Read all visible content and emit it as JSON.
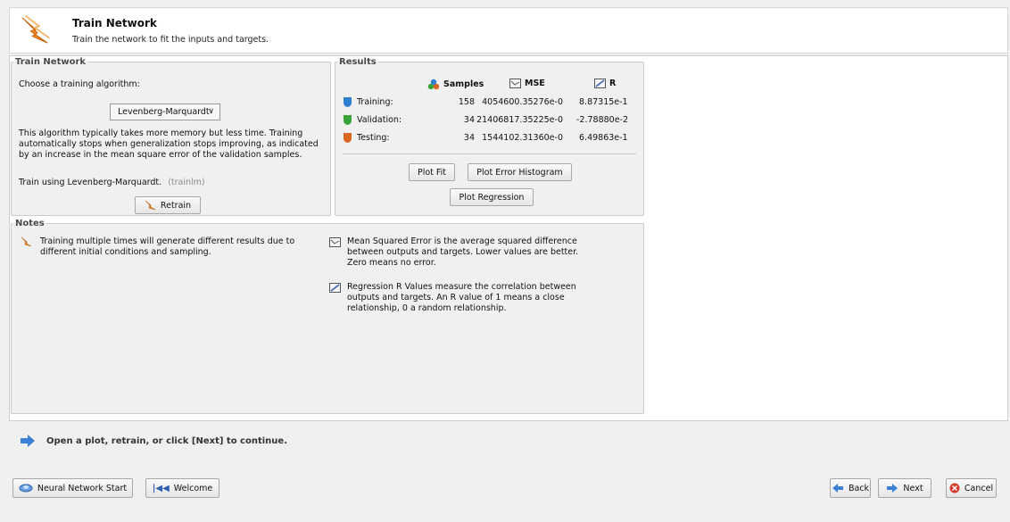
{
  "header": {
    "title": "Train Network",
    "subtitle": "Train the network to fit the inputs and targets.",
    "icon": "train-network-icon"
  },
  "train_panel": {
    "legend": "Train Network",
    "choose_label": "Choose a training algorithm:",
    "algorithm_selected": "Levenberg-Marquardt",
    "description": "This algorithm typically takes more memory but less time. Training automatically stops when generalization stops improving, as indicated by an increase in the mean square error of the validation samples.",
    "train_using": "Train using Levenberg-Marquardt.",
    "train_fn": "(trainlm)",
    "retrain_label": "Retrain"
  },
  "results_panel": {
    "legend": "Results",
    "columns": {
      "samples": "Samples",
      "mse": "MSE",
      "r": "R"
    },
    "rows": [
      {
        "label": "Training:",
        "samples": "158",
        "mse": "4054600.35276e-0",
        "r": "8.87315e-1",
        "color": "#2f7fd1"
      },
      {
        "label": "Validation:",
        "samples": "34",
        "mse": "21406817.35225e-0",
        "r": "-2.78880e-2",
        "color": "#3aa33a"
      },
      {
        "label": "Testing:",
        "samples": "34",
        "mse": "1544102.31360e-0",
        "r": "6.49863e-1",
        "color": "#d9661f"
      }
    ],
    "plot_fit_label": "Plot Fit",
    "plot_error_histogram_label": "Plot Error Histogram",
    "plot_regression_label": "Plot Regression"
  },
  "notes_panel": {
    "legend": "Notes",
    "note_training": "Training multiple times will generate different results due to different initial conditions and sampling.",
    "note_mse": "Mean Squared Error is the average squared difference between outputs and targets. Lower values are better. Zero means no error.",
    "note_r": "Regression R Values measure the correlation between outputs and targets. An R value of 1 means a close relationship, 0 a random relationship."
  },
  "status": {
    "message": "Open a plot, retrain, or click [Next] to continue."
  },
  "footer": {
    "nn_start_label": "Neural Network Start",
    "welcome_label": "Welcome",
    "back_label": "Back",
    "next_label": "Next",
    "cancel_label": "Cancel"
  }
}
